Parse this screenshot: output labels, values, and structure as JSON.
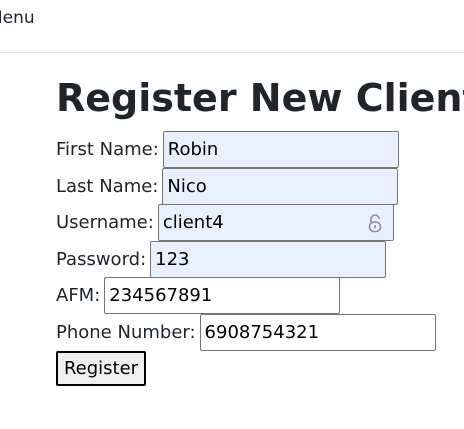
{
  "header": {
    "menu_text": "Menu"
  },
  "page": {
    "title": "Register New Client"
  },
  "form": {
    "first_name": {
      "label": "First Name:",
      "value": "Robin"
    },
    "last_name": {
      "label": "Last Name:",
      "value": "Nico"
    },
    "username": {
      "label": "Username:",
      "value": "client4",
      "icon": "lock-open-icon"
    },
    "password": {
      "label": "Password:",
      "value": "123"
    },
    "afm": {
      "label": "AFM:",
      "value": "234567891"
    },
    "phone": {
      "label": "Phone Number:",
      "value": "6908754321"
    },
    "register_label": "Register"
  },
  "colors": {
    "autofill_bg": "#e8f0fe",
    "button_bg": "#efefef"
  }
}
